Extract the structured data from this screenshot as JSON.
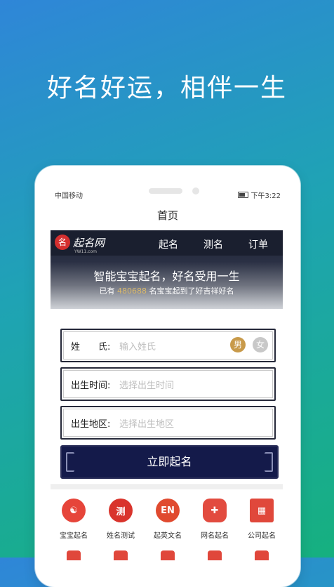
{
  "headline": "好名好运，相伴一生",
  "status_bar": {
    "carrier": "中国移动",
    "time": "下午3:22"
  },
  "page_title": "首页",
  "hero": {
    "logo_text": "起名网",
    "logo_sub": "YW11.com",
    "nav": [
      "起名",
      "测名",
      "订单"
    ],
    "slogan": "智能宝宝起名，好名受用一生",
    "count_prefix": "已有 ",
    "count_value": "480688",
    "count_suffix": " 名宝宝起到了好吉祥好名"
  },
  "form": {
    "surname_label": "姓　　氏:",
    "surname_placeholder": "输入姓氏",
    "male": "男",
    "female": "女",
    "birth_time_label": "出生时间:",
    "birth_time_placeholder": "选择出生时间",
    "birth_place_label": "出生地区:",
    "birth_place_placeholder": "选择出生地区",
    "submit": "立即起名"
  },
  "shortcuts": [
    {
      "label": "宝宝起名",
      "icon": "yin-yang-icon",
      "color": "#e6453a"
    },
    {
      "label": "姓名测试",
      "icon": "test-seal-icon",
      "color": "#d9342c"
    },
    {
      "label": "起英文名",
      "icon": "en-icon",
      "color": "#e04a2f"
    },
    {
      "label": "网名起名",
      "icon": "gamepad-icon",
      "color": "#e24b3f"
    },
    {
      "label": "公司起名",
      "icon": "building-icon",
      "color": "#e0483b"
    }
  ],
  "colors": {
    "accent_gold": "#d9b86b",
    "submit_bg": "#141a4a",
    "male": "#c89a4a",
    "female": "#c8c8c8"
  }
}
